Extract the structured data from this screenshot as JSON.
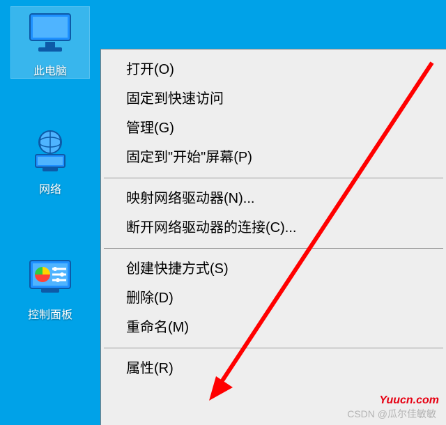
{
  "desktop": {
    "icons": [
      {
        "id": "this-pc",
        "label": "此电脑",
        "selected": true
      },
      {
        "id": "network",
        "label": "网络",
        "selected": false
      },
      {
        "id": "control-panel",
        "label": "控制面板",
        "selected": false
      }
    ]
  },
  "context_menu": {
    "groups": [
      [
        "打开(O)",
        "固定到快速访问",
        "管理(G)",
        "固定到\"开始\"屏幕(P)"
      ],
      [
        "映射网络驱动器(N)...",
        "断开网络驱动器的连接(C)..."
      ],
      [
        "创建快捷方式(S)",
        "删除(D)",
        "重命名(M)"
      ],
      [
        "属性(R)"
      ]
    ]
  },
  "watermarks": {
    "site": "Yuucn.com",
    "csdn": "CSDN @瓜尔佳敏敏"
  },
  "annotation": {
    "arrow_target": "属性(R)"
  }
}
